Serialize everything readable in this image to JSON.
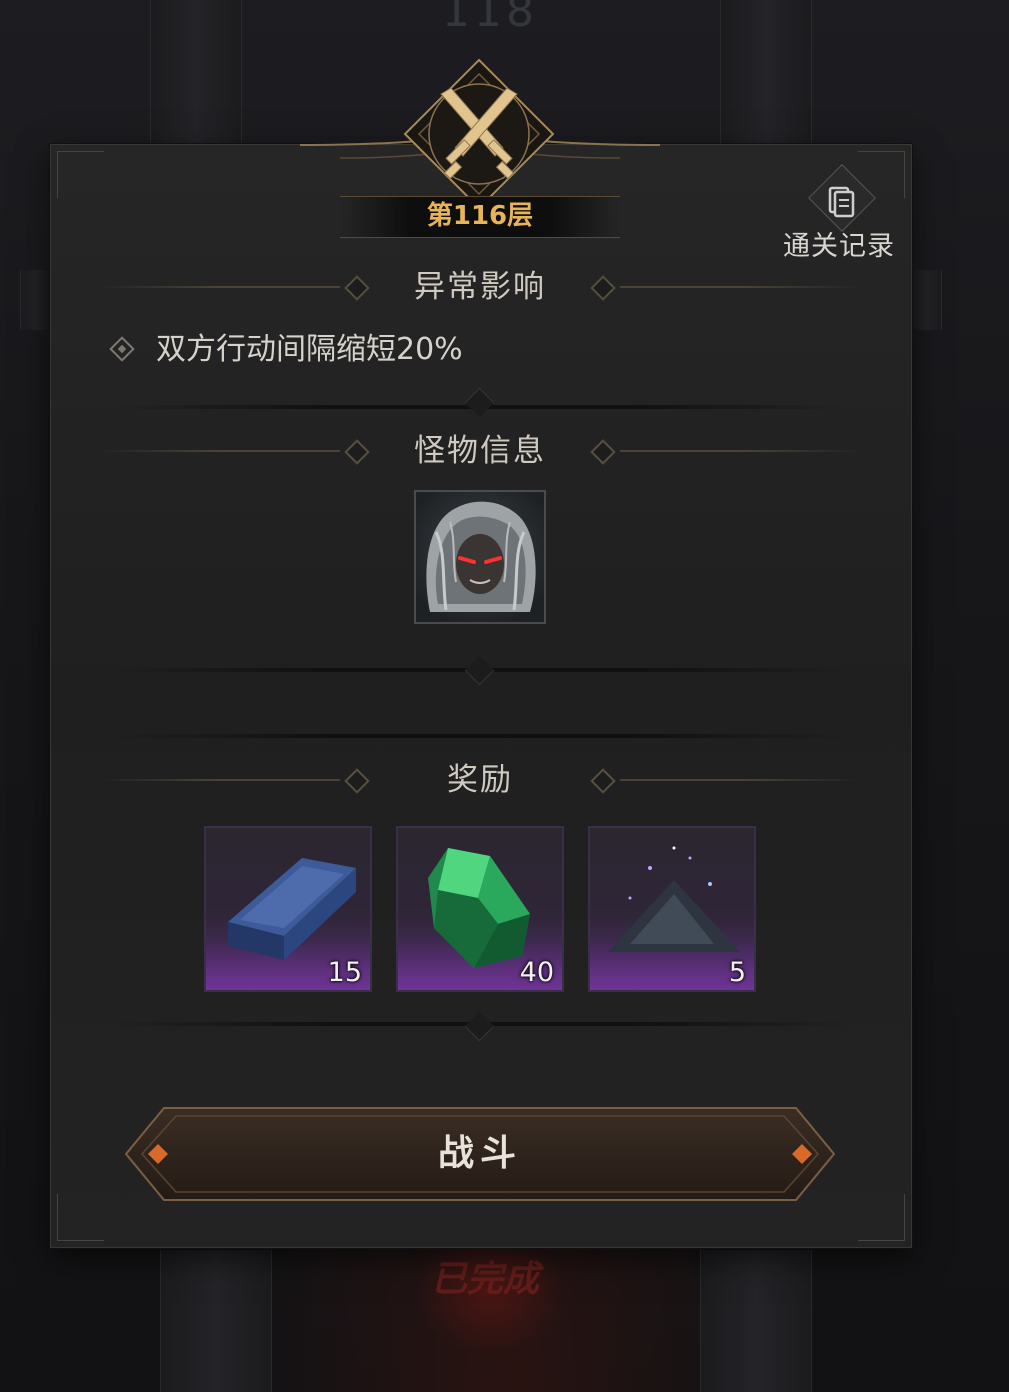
{
  "background": {
    "floor_above": "118",
    "floor_below_status": "已完成"
  },
  "header": {
    "floor_title": "第116层",
    "records_label": "通关记录",
    "records_icon": "scroll-document-icon",
    "emblem_icon": "crossed-swords-icon"
  },
  "abnormal": {
    "title": "异常影响",
    "effects": [
      {
        "text": "双方行动间隔缩短20%"
      }
    ]
  },
  "monsters": {
    "title": "怪物信息",
    "items": [
      {
        "icon": "monster-portrait-icon"
      }
    ]
  },
  "rewards": {
    "title": "奖励",
    "items": [
      {
        "icon": "blue-ingot-icon",
        "count": "15"
      },
      {
        "icon": "green-crystal-icon",
        "count": "40"
      },
      {
        "icon": "dark-dust-pile-icon",
        "count": "5"
      }
    ]
  },
  "actions": {
    "fight_label": "战斗"
  },
  "colors": {
    "accent_gold": "#e8b45a",
    "panel_bg": "#222222",
    "rarity_purple": "#5a2f7a"
  }
}
